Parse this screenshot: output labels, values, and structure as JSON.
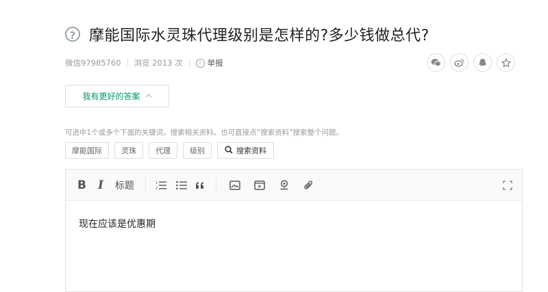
{
  "question": {
    "icon": "question-circle-icon",
    "title": "摩能国际水灵珠代理级别是怎样的?多少钱做总代?"
  },
  "meta": {
    "author": "微信97985760",
    "views": "浏览 2013 次",
    "report_label": "举报"
  },
  "share": {
    "icons": [
      "wechat-icon",
      "weibo-icon",
      "qq-icon",
      "star-icon"
    ]
  },
  "answer_button": {
    "label": "我有更好的答案",
    "chevron": "^"
  },
  "hint": "可选中1个或多个下面的关键词，搜索相关资料。也可直接点“搜索资料”搜索整个问题。",
  "tags": [
    "摩能国际",
    "灵珠",
    "代理",
    "级别"
  ],
  "search_button": {
    "label": "搜索资料"
  },
  "toolbar": {
    "bold": "B",
    "italic": "I",
    "heading": "标题",
    "quote": "66"
  },
  "editor": {
    "content": "现在应该是优惠期"
  },
  "colors": {
    "accent_green": "#009a61",
    "muted_text": "#999999",
    "border": "#dcdcdc"
  }
}
